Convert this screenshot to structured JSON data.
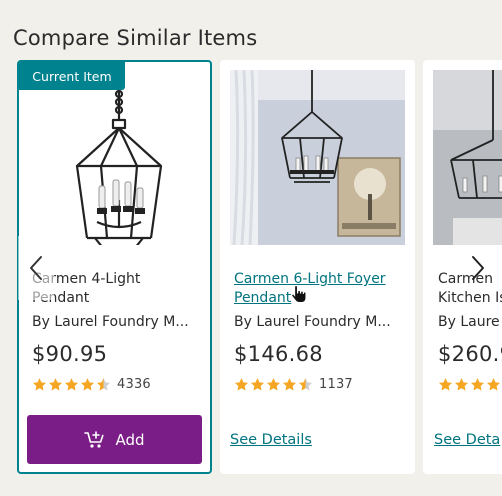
{
  "section": {
    "title": "Compare Similar Items"
  },
  "items": [
    {
      "badge": "Current Item",
      "title_line1": "Carmen 4-Light",
      "title_line2": "Pendant",
      "brand": "By Laurel Foundry M...",
      "price": "$90.95",
      "rating": 4.5,
      "review_count": "4336",
      "action_label": "Add"
    },
    {
      "title_line1": "Carmen 6-Light Foyer",
      "title_line2": "Pendant",
      "brand": "By Laurel Foundry M...",
      "price": "$146.68",
      "rating": 4.5,
      "review_count": "1137",
      "action_label": "See Details"
    },
    {
      "title_line1": "Carmen",
      "title_line2": "Kitchen Is",
      "brand": "By Laure",
      "price": "$260.9",
      "action_label": "See Deta"
    }
  ],
  "icons": {
    "prev": "chevron-left-icon",
    "next": "chevron-right-icon",
    "cart": "cart-plus-icon",
    "star": "star-icon",
    "cursor": "hand-pointer-icon"
  },
  "colors": {
    "accent": "#00838f",
    "link": "#00747f",
    "button": "#7b1d86",
    "star": "#f5a623",
    "background": "#f2f0eb"
  }
}
